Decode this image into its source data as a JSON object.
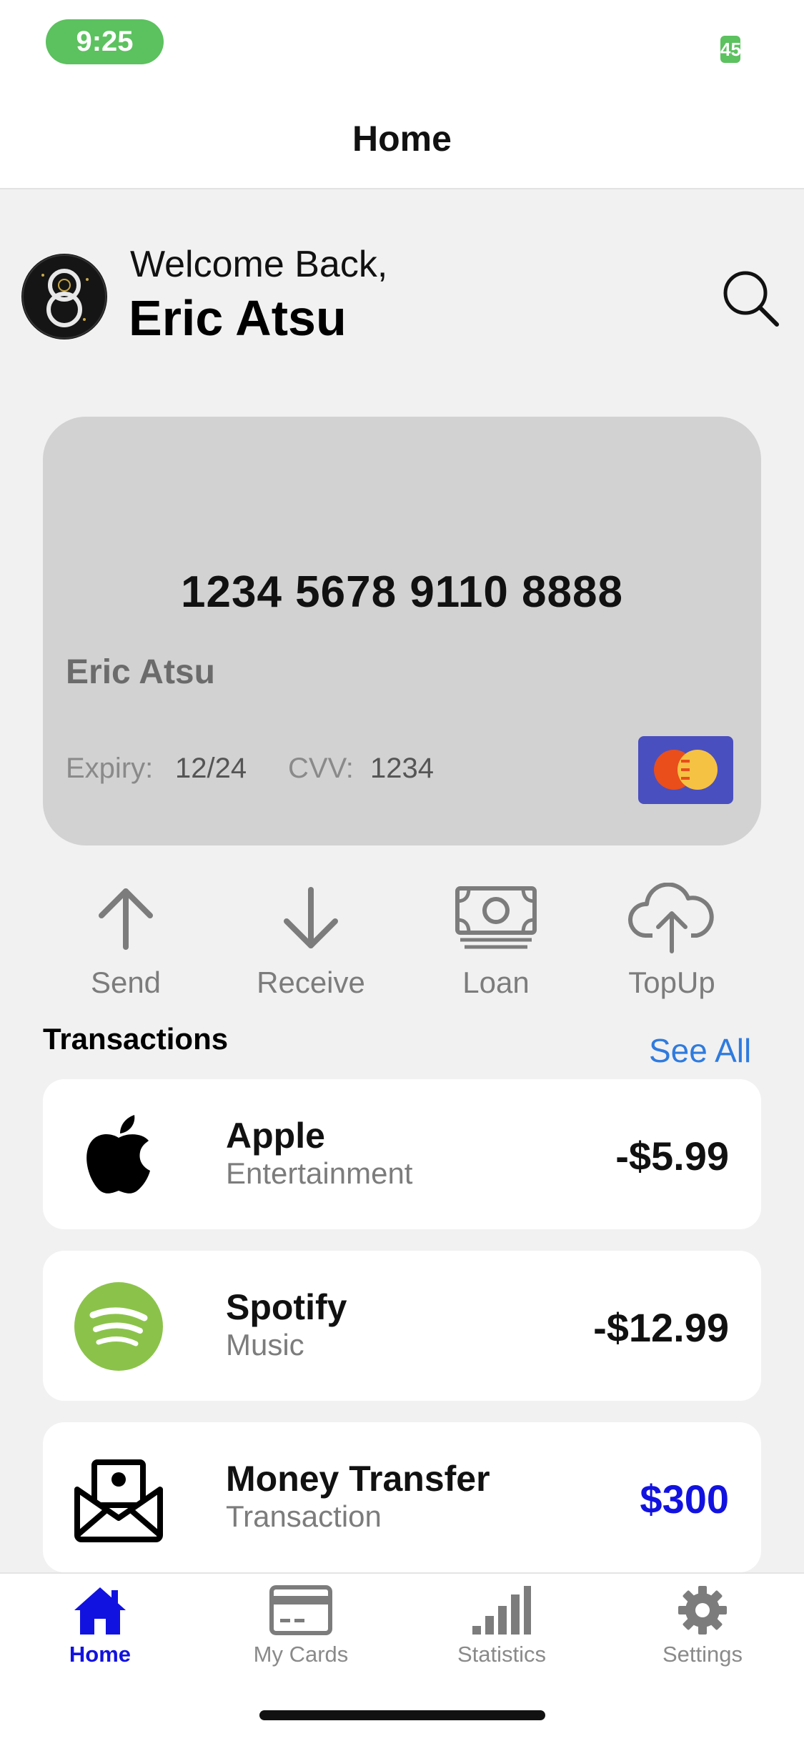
{
  "status_bar": {
    "time": "9:25",
    "battery": "45"
  },
  "nav": {
    "title": "Home"
  },
  "greeting": {
    "welcome": "Welcome Back,",
    "name": "Eric Atsu"
  },
  "card": {
    "number": "1234 5678 9110 8888",
    "holder": "Eric Atsu",
    "expiry_label": "Expiry:",
    "expiry": "12/24",
    "cvv_label": "CVV:",
    "cvv": "1234",
    "brand_icon": "mastercard-logo"
  },
  "actions": [
    {
      "label": "Send",
      "icon": "arrow-up-icon"
    },
    {
      "label": "Receive",
      "icon": "arrow-down-icon"
    },
    {
      "label": "Loan",
      "icon": "cash-icon"
    },
    {
      "label": "TopUp",
      "icon": "cloud-upload-icon"
    }
  ],
  "transactions": {
    "title": "Transactions",
    "see_all": "See All",
    "items": [
      {
        "name": "Apple",
        "category": "Entertainment",
        "amount": "-$5.99",
        "icon": "apple-logo"
      },
      {
        "name": "Spotify",
        "category": "Music",
        "amount": "-$12.99",
        "icon": "spotify-logo"
      },
      {
        "name": "Money Transfer",
        "category": "Transaction",
        "amount": "$300",
        "icon": "envelope-icon"
      }
    ]
  },
  "tabs": [
    {
      "label": "Home",
      "icon": "home-icon",
      "active": true
    },
    {
      "label": "My Cards",
      "icon": "card-icon",
      "active": false
    },
    {
      "label": "Statistics",
      "icon": "signal-bars-icon",
      "active": false
    },
    {
      "label": "Settings",
      "icon": "gear-icon",
      "active": false
    }
  ],
  "colors": {
    "accent": "#1212e0",
    "link": "#2f7bde",
    "status_green": "#5cc15f",
    "card_bg": "#d2d2d2"
  }
}
